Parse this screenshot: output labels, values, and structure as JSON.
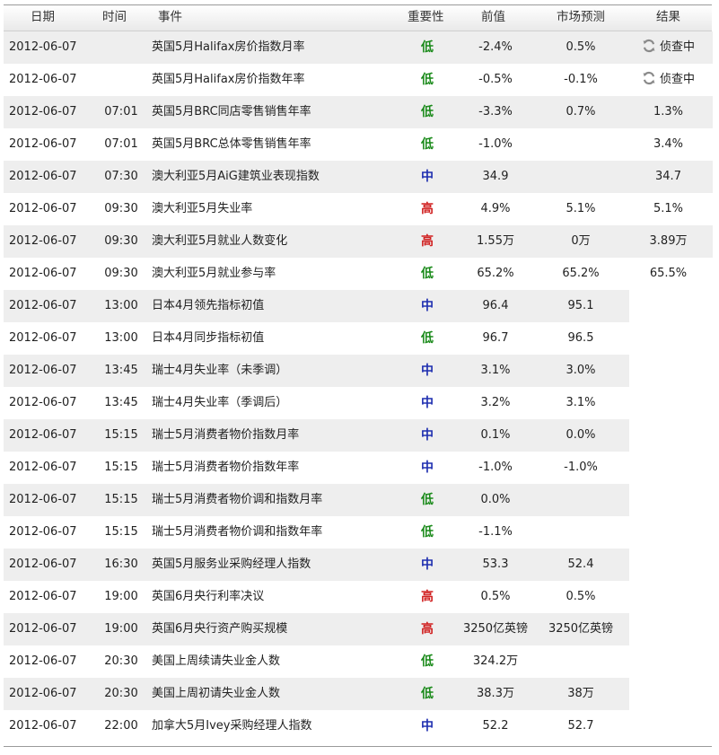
{
  "header": {
    "date": "日期",
    "time": "时间",
    "event": "事件",
    "importance": "重要性",
    "previous": "前值",
    "forecast": "市场预测",
    "result": "结果"
  },
  "colors": {
    "low": "#1a8a1a",
    "mid": "#1f2fb0",
    "high": "#d02020"
  },
  "rows": [
    {
      "date": "2012-06-07",
      "time": "",
      "event": "英国5月Halifax房价指数月率",
      "imp": "低",
      "level": "low",
      "prev": "-2.4%",
      "fore": "0.5%",
      "result": "侦查中",
      "pending": true,
      "icon": "refresh-icon"
    },
    {
      "date": "2012-06-07",
      "time": "",
      "event": "英国5月Halifax房价指数年率",
      "imp": "低",
      "level": "low",
      "prev": "-0.5%",
      "fore": "-0.1%",
      "result": "侦查中",
      "pending": true,
      "icon": "refresh-icon"
    },
    {
      "date": "2012-06-07",
      "time": "07:01",
      "event": "英国5月BRC同店零售销售年率",
      "imp": "低",
      "level": "low",
      "prev": "-3.3%",
      "fore": "0.7%",
      "result": "1.3%"
    },
    {
      "date": "2012-06-07",
      "time": "07:01",
      "event": "英国5月BRC总体零售销售年率",
      "imp": "低",
      "level": "low",
      "prev": "-1.0%",
      "fore": "",
      "result": "3.4%"
    },
    {
      "date": "2012-06-07",
      "time": "07:30",
      "event": "澳大利亚5月AiG建筑业表现指数",
      "imp": "中",
      "level": "mid",
      "prev": "34.9",
      "fore": "",
      "result": "34.7"
    },
    {
      "date": "2012-06-07",
      "time": "09:30",
      "event": "澳大利亚5月失业率",
      "imp": "高",
      "level": "high",
      "prev": "4.9%",
      "fore": "5.1%",
      "result": "5.1%"
    },
    {
      "date": "2012-06-07",
      "time": "09:30",
      "event": "澳大利亚5月就业人数变化",
      "imp": "高",
      "level": "high",
      "prev": "1.55万",
      "fore": "0万",
      "result": "3.89万"
    },
    {
      "date": "2012-06-07",
      "time": "09:30",
      "event": "澳大利亚5月就业参与率",
      "imp": "低",
      "level": "low",
      "prev": "65.2%",
      "fore": "65.2%",
      "result": "65.5%"
    },
    {
      "date": "2012-06-07",
      "time": "13:00",
      "event": "日本4月领先指标初值",
      "imp": "中",
      "level": "mid",
      "prev": "96.4",
      "fore": "95.1",
      "result": ""
    },
    {
      "date": "2012-06-07",
      "time": "13:00",
      "event": "日本4月同步指标初值",
      "imp": "低",
      "level": "low",
      "prev": "96.7",
      "fore": "96.5",
      "result": ""
    },
    {
      "date": "2012-06-07",
      "time": "13:45",
      "event": "瑞士4月失业率（未季调）",
      "imp": "中",
      "level": "mid",
      "prev": "3.1%",
      "fore": "3.0%",
      "result": ""
    },
    {
      "date": "2012-06-07",
      "time": "13:45",
      "event": "瑞士4月失业率（季调后）",
      "imp": "中",
      "level": "mid",
      "prev": "3.2%",
      "fore": "3.1%",
      "result": ""
    },
    {
      "date": "2012-06-07",
      "time": "15:15",
      "event": "瑞士5月消费者物价指数月率",
      "imp": "中",
      "level": "mid",
      "prev": "0.1%",
      "fore": "0.0%",
      "result": ""
    },
    {
      "date": "2012-06-07",
      "time": "15:15",
      "event": "瑞士5月消费者物价指数年率",
      "imp": "中",
      "level": "mid",
      "prev": "-1.0%",
      "fore": "-1.0%",
      "result": ""
    },
    {
      "date": "2012-06-07",
      "time": "15:15",
      "event": "瑞士5月消费者物价调和指数月率",
      "imp": "低",
      "level": "low",
      "prev": "0.0%",
      "fore": "",
      "result": ""
    },
    {
      "date": "2012-06-07",
      "time": "15:15",
      "event": "瑞士5月消费者物价调和指数年率",
      "imp": "低",
      "level": "low",
      "prev": "-1.1%",
      "fore": "",
      "result": ""
    },
    {
      "date": "2012-06-07",
      "time": "16:30",
      "event": "英国5月服务业采购经理人指数",
      "imp": "中",
      "level": "mid",
      "prev": "53.3",
      "fore": "52.4",
      "result": ""
    },
    {
      "date": "2012-06-07",
      "time": "19:00",
      "event": "英国6月央行利率决议",
      "imp": "高",
      "level": "high",
      "prev": "0.5%",
      "fore": "0.5%",
      "result": ""
    },
    {
      "date": "2012-06-07",
      "time": "19:00",
      "event": "英国6月央行资产购买规模",
      "imp": "高",
      "level": "high",
      "prev": "3250亿英镑",
      "fore": "3250亿英镑",
      "result": ""
    },
    {
      "date": "2012-06-07",
      "time": "20:30",
      "event": "美国上周续请失业金人数",
      "imp": "低",
      "level": "low",
      "prev": "324.2万",
      "fore": "",
      "result": ""
    },
    {
      "date": "2012-06-07",
      "time": "20:30",
      "event": "美国上周初请失业金人数",
      "imp": "低",
      "level": "low",
      "prev": "38.3万",
      "fore": "38万",
      "result": ""
    },
    {
      "date": "2012-06-07",
      "time": "22:00",
      "event": "加拿大5月Ivey采购经理人指数",
      "imp": "中",
      "level": "mid",
      "prev": "52.2",
      "fore": "52.7",
      "result": ""
    }
  ]
}
